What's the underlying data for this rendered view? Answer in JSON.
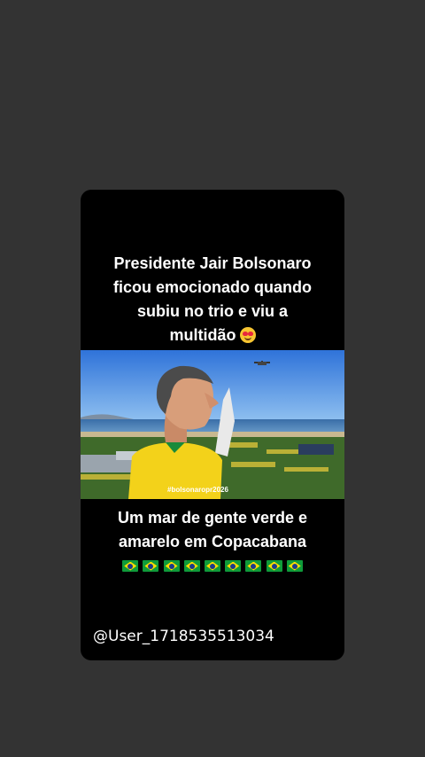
{
  "post": {
    "headline": "Presidente Jair Bolsonaro\nficou emocionado quando\nsubiu no trio e viu a\nmultidão",
    "headline_emoji": "heart-eyes-emoji",
    "watermark": "#bolsonaropr2026",
    "subline_1": "Um mar de gente verde e",
    "subline_2": "amarelo em Copacabana",
    "flags": [
      "brazil-flag",
      "brazil-flag",
      "brazil-flag",
      "brazil-flag",
      "brazil-flag",
      "brazil-flag",
      "brazil-flag",
      "brazil-flag",
      "brazil-flag"
    ],
    "username": "@User_1718535513034"
  },
  "colors": {
    "page_background": "#333333",
    "card_background": "#000000",
    "text": "#ffffff",
    "flag_green": "#0f9b3a",
    "flag_yellow": "#fedd00",
    "flag_blue": "#1b3a8c"
  }
}
